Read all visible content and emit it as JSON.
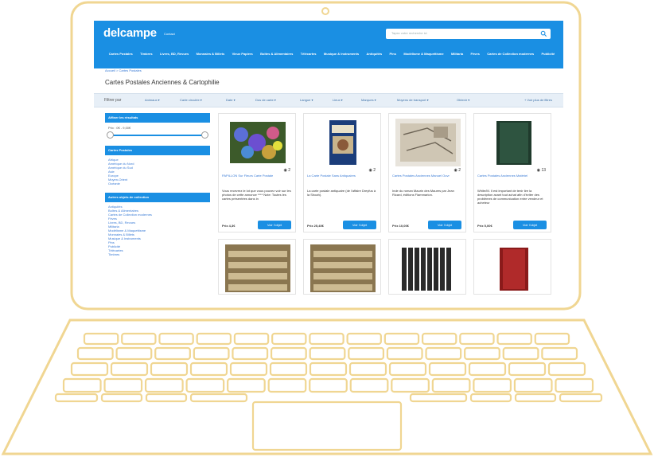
{
  "colors": {
    "outline": "#f0d692",
    "brand": "#1a8fe3",
    "link": "#3a7bd5"
  },
  "header": {
    "logo": "delcampe",
    "logo_sub": "Contact",
    "search_placeholder": "Tapez votre recherche ici",
    "search_icon": "search-icon",
    "nav": [
      "Cartes Postales",
      "Timbres",
      "Livres, BD, Revues",
      "Monnaies & Billets",
      "Vieux Papiers",
      "Boîtes & Alimentaires",
      "Télécartes",
      "Musique & Instruments",
      "Antiquités",
      "Pins",
      "Modélisme & Maquettisme",
      "Militaria",
      "Fèves",
      "Cartes de Collection modernes",
      "Publicité"
    ]
  },
  "breadcrumb": "Accueil > Cartes Postales",
  "page_title": "Cartes Postales Anciennes & Cartophilie",
  "filterbar": {
    "label": "Filtrer par",
    "filters": [
      "Animaux",
      "Carte circulée",
      "Date",
      "Dos de carte",
      "Langue",
      "Lieux",
      "Marques",
      "Moyens de transport",
      "Obtenir"
    ],
    "more": "+ Voir plus de filtres"
  },
  "sidebar": {
    "refine_title": "Affiner les résultats",
    "price_label": "Prix : 0€ - 9,00€",
    "postcards_title": "Cartes Postales",
    "postcards_links": [
      "Afrique",
      "Amérique du Nord",
      "Amérique du Sud",
      "Asie",
      "Europe",
      "Moyen-Orient",
      "Océanie"
    ],
    "others_title": "Autres objets de collection",
    "others_links": [
      "Antiquités",
      "Boîtes & Alimentaires",
      "Cartes de Collection modernes",
      "Fèves",
      "Livres, BD, Revues",
      "Militaria",
      "Modélisme & Maquettisme",
      "Monnaies & Billets",
      "Musique & Instruments",
      "Pins",
      "Publicité",
      "Télécartes",
      "Timbres"
    ]
  },
  "cards": [
    {
      "title": "PAPILLON Sur Fleurs Carte Postale",
      "desc": "Vous recevrez le lot que vous pouvez voir sur les photos de cette annonce **** Note: Toutes les cartes présentées dans in",
      "price": "Prix 4,3€",
      "button": "Voir l'objet",
      "photos": "2"
    },
    {
      "title": "La Carte Postale Sans Antiquaires",
      "desc": "La carte postale antiquaire (de l'affaire Dreyfus à la Shoah).",
      "price": "Prix 25,40€",
      "button": "Voir l'objet",
      "photos": "2"
    },
    {
      "title": "Cartes Postales Anciennes Manuel Ouvr",
      "desc": "Inde du roman Maurin des Maures par Jean Ricard, éditions Flammarion.",
      "price": "Prix 10,00€",
      "button": "Voir l'objet",
      "photos": "2"
    },
    {
      "title": "Cartes Postales Anciennes Matériel",
      "desc": "White/M. Il est important de tenir lire la description avant tout achat afin d'éviter des problèmes de communication entre vendeur et acheteur",
      "price": "Prix 5,00€",
      "button": "Voir l'objet",
      "photos": "13"
    }
  ]
}
